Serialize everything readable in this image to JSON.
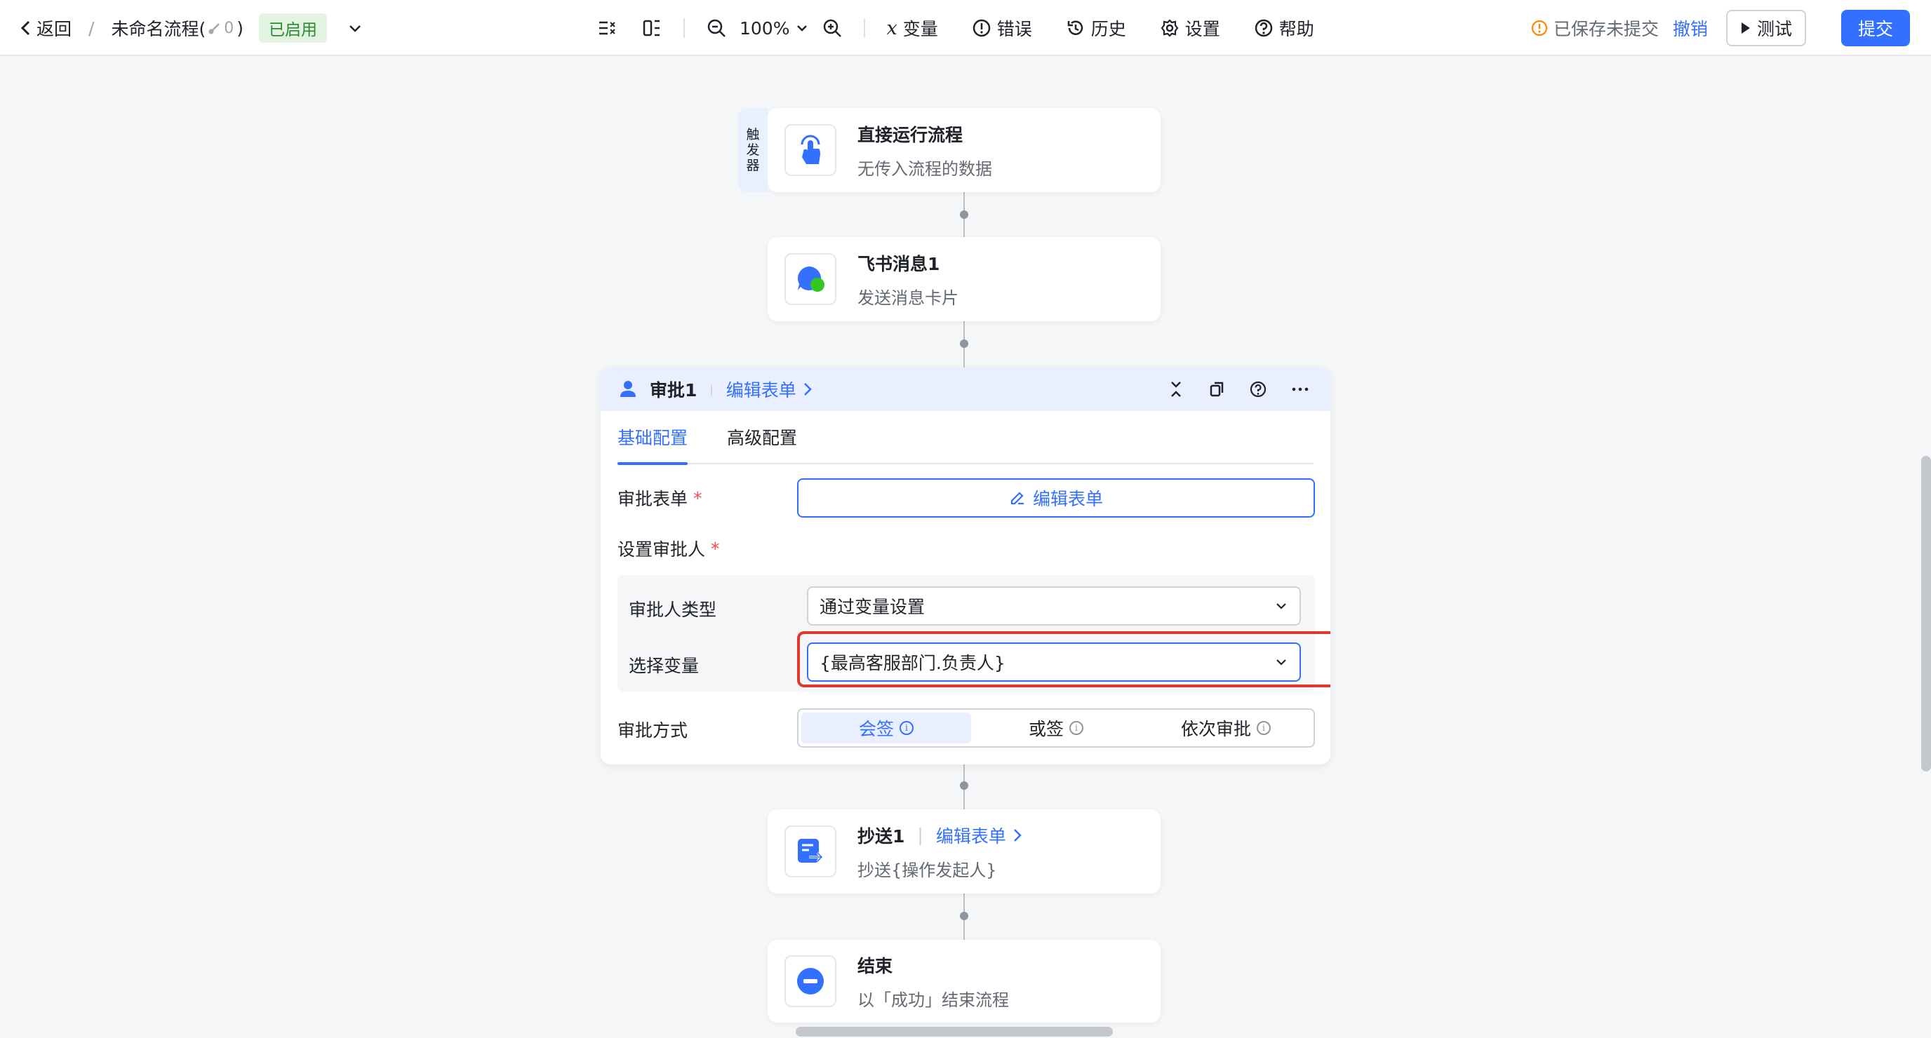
{
  "header": {
    "back_label": "返回",
    "separator": "/",
    "flow_title": "未命名流程(",
    "link_count": "0",
    "title_close": ")",
    "status_badge": "已启用"
  },
  "toolbar": {
    "zoom_level": "100%",
    "variables_label": "变量",
    "errors_label": "错误",
    "history_label": "历史",
    "settings_label": "设置",
    "help_label": "帮助"
  },
  "header_right": {
    "saved_status": "已保存未提交",
    "undo_label": "撤销",
    "test_label": "测试",
    "submit_label": "提交"
  },
  "nodes": {
    "trigger": {
      "tag_chars": [
        "触",
        "发",
        "器"
      ],
      "title": "直接运行流程",
      "subtitle": "无传入流程的数据"
    },
    "message": {
      "title": "飞书消息1",
      "subtitle": "发送消息卡片"
    },
    "cc": {
      "title": "抄送1",
      "link": "编辑表单",
      "subtitle": "抄送{操作发起人}"
    },
    "end": {
      "title": "结束",
      "subtitle": "以「成功」结束流程"
    }
  },
  "approval_panel": {
    "title": "审批1",
    "edit_form_link": "编辑表单",
    "tabs": [
      "基础配置",
      "高级配置"
    ],
    "form_label": "审批表单",
    "form_button": "编辑表单",
    "approver_label": "设置审批人",
    "approver_type_label": "审批人类型",
    "approver_type_value": "通过变量设置",
    "variable_label": "选择变量",
    "variable_value": "{最高客服部门.负责人}",
    "mode_label": "审批方式",
    "modes": [
      "会签",
      "或签",
      "依次审批"
    ]
  },
  "colors": {
    "brand": "#3370ff",
    "highlight": "#e0382c",
    "enabled_green": "#2a8a34"
  }
}
